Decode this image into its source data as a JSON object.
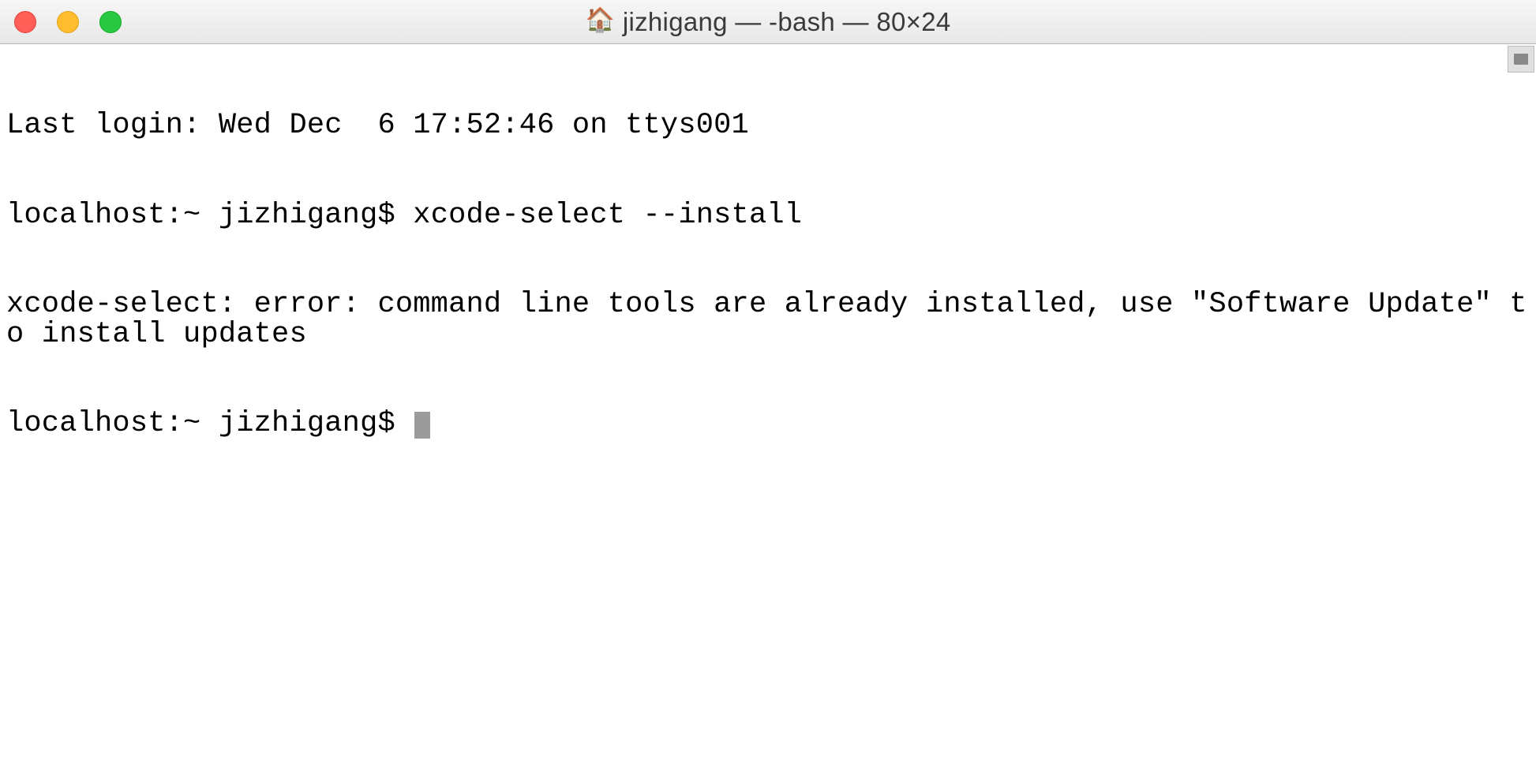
{
  "titlebar": {
    "title": "jizhigang — -bash — 80×24",
    "home_icon": "🏠"
  },
  "terminal": {
    "login_line": "Last login: Wed Dec  6 17:52:46 on ttys001",
    "prompt1": "localhost:~ jizhigang$ ",
    "command1": "xcode-select --install",
    "output1": "xcode-select: error: command line tools are already installed, use \"Software Update\" to install updates",
    "prompt2": "localhost:~ jizhigang$ "
  }
}
